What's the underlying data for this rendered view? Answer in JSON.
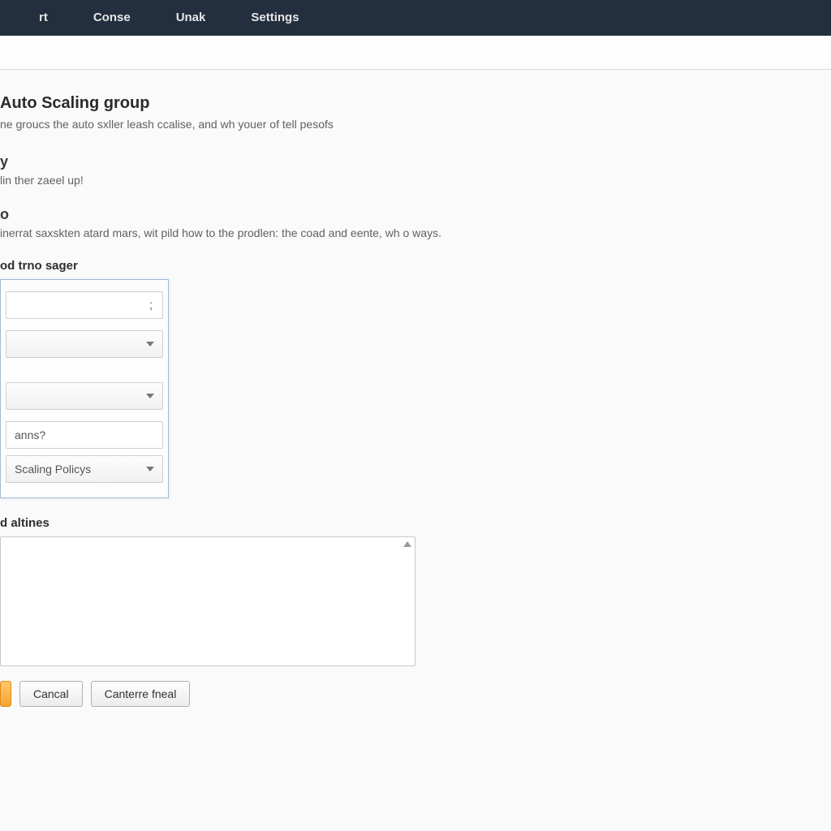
{
  "nav": {
    "items": [
      "rt",
      "Conse",
      "Unak",
      "Settings"
    ]
  },
  "main": {
    "title": "Auto Scaling group",
    "desc": "ne groucs the auto sxller leash ccalise, and wh youer of tell pesofs",
    "sub1_title": "y",
    "sub1_desc": "lin ther zaeel up!",
    "sub2_title": "o",
    "sub2_desc": "inerrat saxskten atard mars, wit pild how to the prodlen: the coad and eente, wh o ways."
  },
  "form": {
    "label": "od trno sager",
    "field1": "",
    "field2": "",
    "field3": "",
    "field4": "anns?",
    "field5": "Scaling Policys",
    "textarea_label": "d altines",
    "textarea_value": ""
  },
  "buttons": {
    "primary": "",
    "cancel": "Cancal",
    "continue": "Canterre fneal"
  }
}
